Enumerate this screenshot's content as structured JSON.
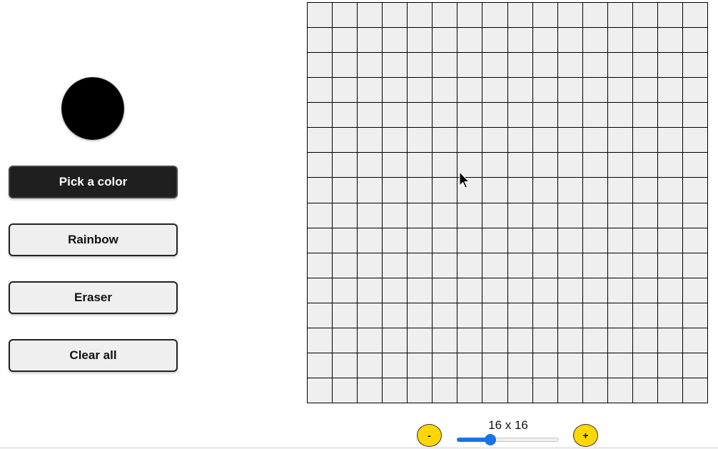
{
  "current_color": "#000000",
  "buttons": {
    "pick_color": "Pick a color",
    "rainbow": "Rainbow",
    "eraser": "Eraser",
    "clear_all": "Clear all"
  },
  "grid": {
    "size": 16,
    "cell_color": "#efefef",
    "line_color": "#000000"
  },
  "size_controls": {
    "minus_label": "-",
    "plus_label": "+",
    "size_text": "16 x 16",
    "slider_value_fraction": 0.33,
    "slider_color": "#1a73e8",
    "button_color": "#ffd700"
  },
  "icons": {
    "cursor": "mouse-pointer-icon"
  }
}
